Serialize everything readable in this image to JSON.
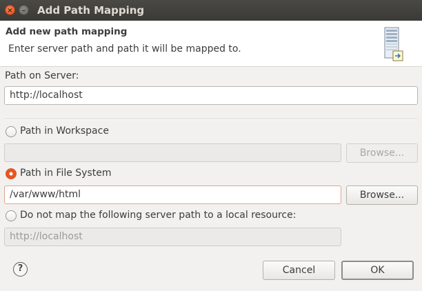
{
  "window": {
    "title": "Add Path Mapping"
  },
  "banner": {
    "title": "Add new path mapping",
    "description": "Enter server path and path it will be mapped to."
  },
  "server_path": {
    "label": "Path on Server:",
    "value": "http://localhost"
  },
  "options": [
    {
      "label": "Path in Workspace",
      "selected": false,
      "value": "",
      "browse_label": "Browse...",
      "browse_enabled": false
    },
    {
      "label": "Path in File System",
      "selected": true,
      "value": "/var/www/html",
      "browse_label": "Browse...",
      "browse_enabled": true
    },
    {
      "label": "Do not map the following server path to a local resource:",
      "selected": false,
      "value": "http://localhost"
    }
  ],
  "footer": {
    "help_glyph": "?",
    "cancel_label": "Cancel",
    "ok_label": "OK"
  },
  "colors": {
    "accent": "#e95420",
    "titlebar": "#3e3d39",
    "banner_bg": "#ffffff"
  }
}
